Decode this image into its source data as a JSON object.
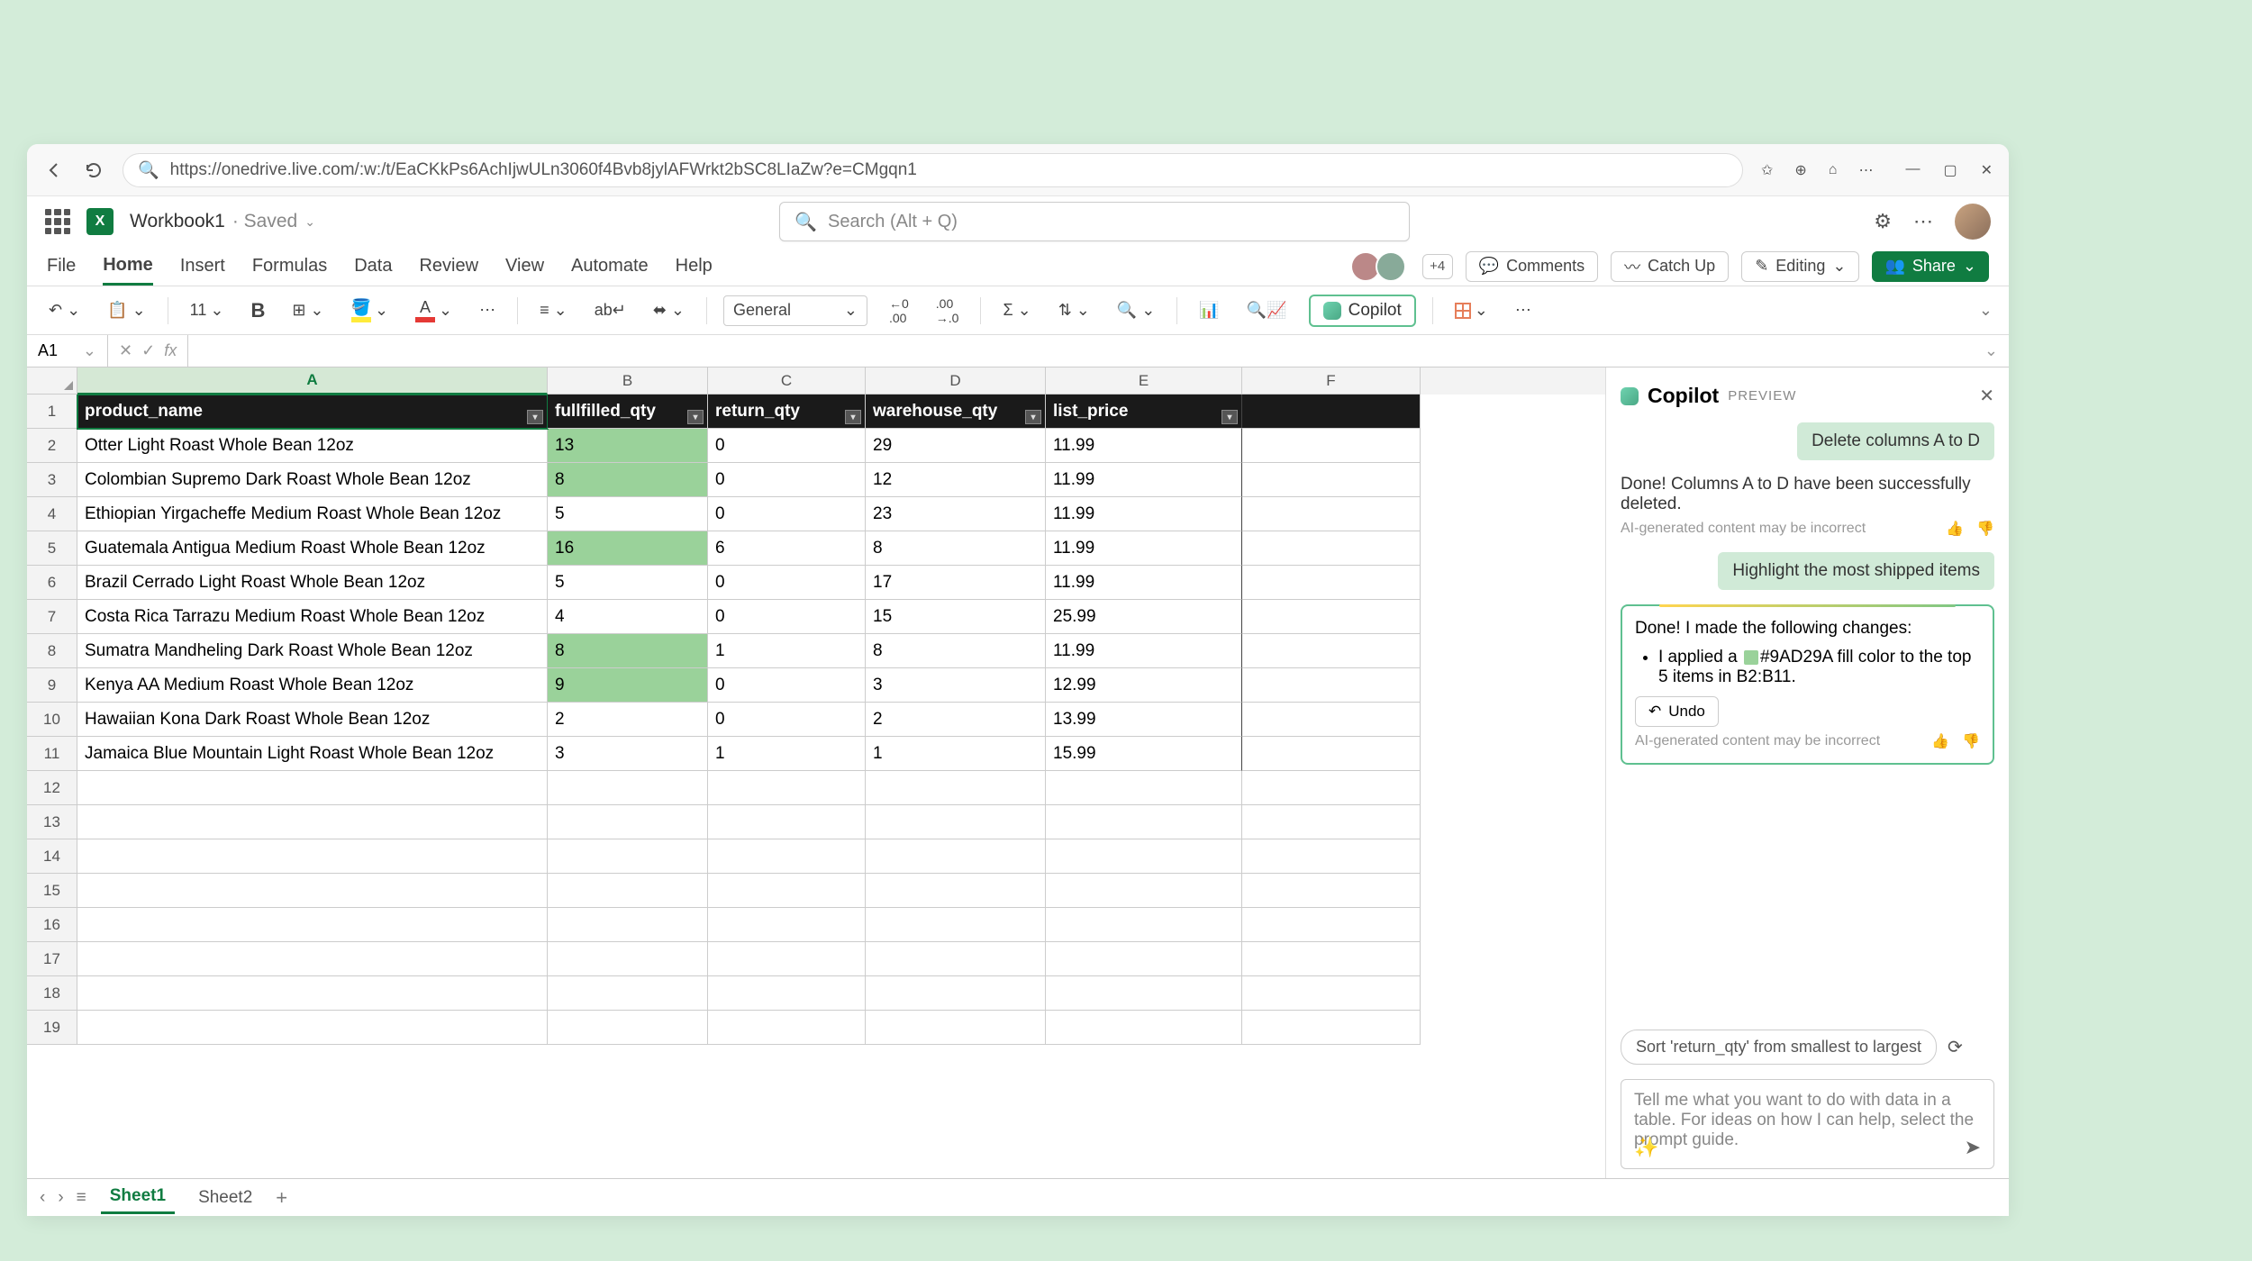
{
  "browser": {
    "url": "https://onedrive.live.com/:w:/t/EaCKkPs6AchIjwULn3060f4Bvb8jylAFWrkt2bSC8LIaZw?e=CMgqn1"
  },
  "header": {
    "filename": "Workbook1",
    "status": "· Saved",
    "search_placeholder": "Search (Alt + Q)"
  },
  "ribbon": {
    "tabs": [
      "File",
      "Home",
      "Insert",
      "Formulas",
      "Data",
      "Review",
      "View",
      "Automate",
      "Help"
    ],
    "active": "Home",
    "presence_extra": "+4",
    "comments": "Comments",
    "catchup": "Catch Up",
    "editing": "Editing",
    "share": "Share"
  },
  "toolbar": {
    "font_size": "11",
    "number_format": "General",
    "copilot": "Copilot"
  },
  "formula": {
    "cell_ref": "A1",
    "fx": "fx",
    "value": ""
  },
  "grid": {
    "cols": [
      "A",
      "B",
      "C",
      "D",
      "E",
      "F"
    ],
    "headers": [
      "product_name",
      "fullfilled_qty",
      "return_qty",
      "warehouse_qty",
      "list_price"
    ],
    "rows": [
      {
        "n": 1
      },
      {
        "n": 2,
        "a": "Otter Light Roast Whole Bean 12oz",
        "b": "13",
        "c": "0",
        "d": "29",
        "e": "11.99",
        "hl": true
      },
      {
        "n": 3,
        "a": "Colombian Supremo Dark Roast Whole Bean 12oz",
        "b": "8",
        "c": "0",
        "d": "12",
        "e": "11.99",
        "hl": true
      },
      {
        "n": 4,
        "a": "Ethiopian Yirgacheffe Medium Roast Whole Bean 12oz",
        "b": "5",
        "c": "0",
        "d": "23",
        "e": "11.99",
        "hl": false
      },
      {
        "n": 5,
        "a": "Guatemala Antigua Medium Roast Whole Bean 12oz",
        "b": "16",
        "c": "6",
        "d": "8",
        "e": "11.99",
        "hl": true
      },
      {
        "n": 6,
        "a": "Brazil Cerrado Light Roast Whole Bean 12oz",
        "b": "5",
        "c": "0",
        "d": "17",
        "e": "11.99",
        "hl": false
      },
      {
        "n": 7,
        "a": "Costa Rica Tarrazu Medium Roast Whole Bean 12oz",
        "b": "4",
        "c": "0",
        "d": "15",
        "e": "25.99",
        "hl": false
      },
      {
        "n": 8,
        "a": "Sumatra Mandheling Dark Roast Whole Bean 12oz",
        "b": "8",
        "c": "1",
        "d": "8",
        "e": "11.99",
        "hl": true
      },
      {
        "n": 9,
        "a": "Kenya AA Medium Roast Whole Bean 12oz",
        "b": "9",
        "c": "0",
        "d": "3",
        "e": "12.99",
        "hl": true
      },
      {
        "n": 10,
        "a": "Hawaiian Kona Dark Roast Whole Bean 12oz",
        "b": "2",
        "c": "0",
        "d": "2",
        "e": "13.99",
        "hl": false
      },
      {
        "n": 11,
        "a": "Jamaica Blue Mountain Light Roast Whole Bean 12oz",
        "b": "3",
        "c": "1",
        "d": "1",
        "e": "15.99",
        "hl": false
      },
      {
        "n": 12
      },
      {
        "n": 13
      },
      {
        "n": 14
      },
      {
        "n": 15
      },
      {
        "n": 16
      },
      {
        "n": 17
      },
      {
        "n": 18
      },
      {
        "n": 19
      }
    ]
  },
  "copilot": {
    "title": "Copilot",
    "badge": "PREVIEW",
    "user1": "Delete columns A to D",
    "ai1": "Done! Columns A to D have been successfully deleted.",
    "disclaimer": "AI-generated content may be incorrect",
    "user2": "Highlight the most shipped items",
    "ai2_intro": "Done! I made the following changes:",
    "ai2_bullet_pre": "I applied a ",
    "ai2_color": "#9AD29A",
    "ai2_bullet_post": " fill color to the top 5 items in B2:B11.",
    "undo": "Undo",
    "suggestion": "Sort 'return_qty' from smallest to largest",
    "placeholder": "Tell me what you want to do with data in a table. For ideas on how I can help, select the prompt guide."
  },
  "sheets": {
    "tabs": [
      "Sheet1",
      "Sheet2"
    ],
    "active": "Sheet1"
  }
}
